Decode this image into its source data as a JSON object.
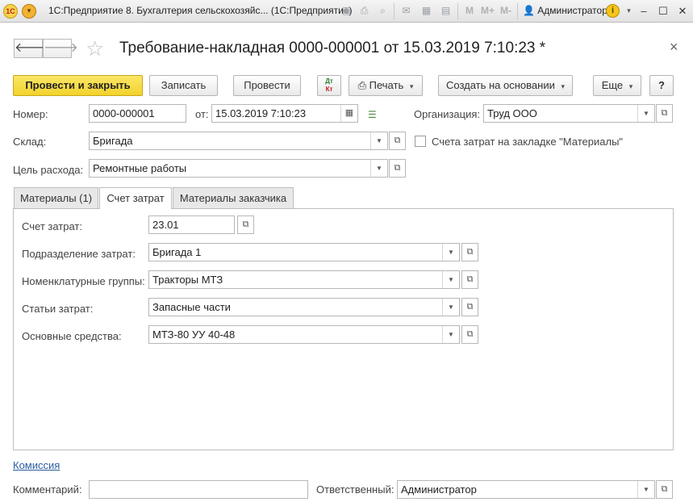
{
  "titlebar": {
    "app_title": "1С:Предприятие 8. Бухгалтерия сельскохозяйс...  (1С:Предприятие)",
    "user": "Администратор",
    "m_buttons": [
      "M",
      "M+",
      "M-"
    ]
  },
  "header": {
    "title": "Требование-накладная 0000-000001 от 15.03.2019 7:10:23 *"
  },
  "toolbar": {
    "post_and_close": "Провести и закрыть",
    "save": "Записать",
    "post": "Провести",
    "dt_label": "Дт",
    "kt_label": "Кт",
    "print": "Печать",
    "create_based": "Создать на основании",
    "more": "Еще",
    "help": "?"
  },
  "form": {
    "number_label": "Номер:",
    "number_value": "0000-000001",
    "date_label": "от:",
    "date_value": "15.03.2019  7:10:23",
    "org_label": "Организация:",
    "org_value": "Труд ООО",
    "warehouse_label": "Склад:",
    "warehouse_value": "Бригада",
    "cost_accounts_checkbox_label": "Счета затрат на закладке \"Материалы\"",
    "purpose_label": "Цель расхода:",
    "purpose_value": "Ремонтные работы"
  },
  "tabs": [
    {
      "label": "Материалы (1)"
    },
    {
      "label": "Счет затрат"
    },
    {
      "label": "Материалы заказчика"
    }
  ],
  "cost_tab": {
    "account_label": "Счет затрат:",
    "account_value": "23.01",
    "division_label": "Подразделение затрат:",
    "division_value": "Бригада 1",
    "nomen_group_label": "Номенклатурные группы:",
    "nomen_group_value": "Тракторы МТЗ",
    "cost_item_label": "Статьи затрат:",
    "cost_item_value": "Запасные части",
    "fixed_asset_label": "Основные средства:",
    "fixed_asset_value": "МТЗ-80 УУ 40-48"
  },
  "footer": {
    "commission_link": "Комиссия",
    "comment_label": "Комментарий:",
    "comment_value": "",
    "responsible_label": "Ответственный:",
    "responsible_value": "Администратор"
  },
  "colors": {
    "primary_button": "#f2d22c",
    "link": "#2a5d9f"
  }
}
